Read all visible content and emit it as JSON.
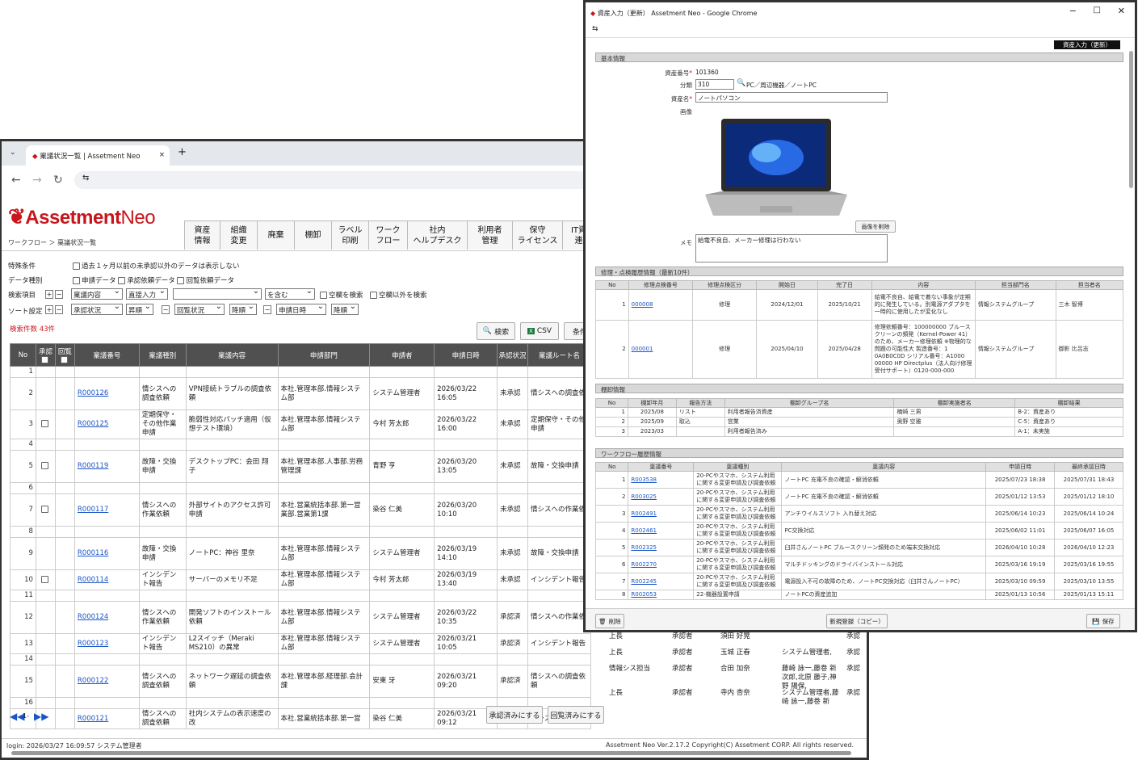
{
  "browser1": {
    "tab_title": "稟議状況一覧 | Assetment Neo"
  },
  "app": {
    "logo_main": "Assetment",
    "logo_neo": "Neo",
    "breadcrumb_root": "ワークフロー",
    "breadcrumb_sep": "＞",
    "breadcrumb_page": "稟議状況一覧",
    "menu": [
      "資産\n情報",
      "組織\n変更",
      "廃棄",
      "棚卸",
      "ラベル\n印刷",
      "ワーク\nフロー",
      "社内\nヘルプデスク",
      "利用者\n管理",
      "保守\nライセンス",
      "IT資\n連"
    ]
  },
  "search": {
    "special_label": "特殊条件",
    "special_opt": "過去１ヶ月以前の未承認以外のデータは表示しない",
    "datatype_label": "データ種別",
    "dt1": "申請データ",
    "dt2": "承認依頼データ",
    "dt3": "回覧依頼データ",
    "item_label": "検索項目",
    "item_field": "稟議内容",
    "item_mode": "直接入力",
    "item_value": "",
    "item_match": "を含む",
    "blank": "空欄を検索",
    "nonblank": "空欄以外を検索",
    "sort_label": "ソート設定",
    "sort1": "承認状況",
    "sort1o": "昇順",
    "sort2": "回覧状況",
    "sort2o": "降順",
    "sort3": "申請日時",
    "sort3o": "降順",
    "count": "検索件数 43件",
    "search_btn": "検索",
    "csv_btn": "CSV",
    "cond_btn": "条件"
  },
  "grid": {
    "headers": [
      "No",
      "承認",
      "回覧",
      "稟議番号",
      "稟議種別",
      "稟議内容",
      "申請部門",
      "申請者",
      "申請日時",
      "承認状況",
      "稟議ルート名"
    ],
    "rows": [
      {
        "no": "1",
        "id": "",
        "type": "",
        "content": "",
        "dept": "",
        "user": "",
        "date": "",
        "status": "",
        "route": "",
        "cb": false
      },
      {
        "no": "2",
        "id": "R000126",
        "type": "情シスへの調査依頼",
        "content": "VPN接続トラブルの調査依頼",
        "dept": "本社.管理本部.情報システム部",
        "user": "システム管理者",
        "date": "2026/03/22 16:05",
        "status": "未承認",
        "route": "情シスへの調査依",
        "cb": false
      },
      {
        "no": "3",
        "id": "R000125",
        "type": "定期保守・その他作業申請",
        "content": "脆弱性対応パッチ適用（仮想テスト環境）",
        "dept": "本社.管理本部.情報システム部",
        "user": "今村 芳太郎",
        "date": "2026/03/22 16:00",
        "status": "未承認",
        "route": "定期保守・その他申請",
        "cb": true
      },
      {
        "no": "4",
        "id": "",
        "type": "",
        "content": "",
        "dept": "",
        "user": "",
        "date": "",
        "status": "",
        "route": "",
        "cb": false
      },
      {
        "no": "5",
        "id": "R000119",
        "type": "故障・交換申請",
        "content": "デスクトップPC：会田 翔子",
        "dept": "本社.管理本部.人事部.労務管理課",
        "user": "青野 亨",
        "date": "2026/03/20 13:05",
        "status": "未承認",
        "route": "故障・交換申請",
        "cb": true
      },
      {
        "no": "6",
        "id": "",
        "type": "",
        "content": "",
        "dept": "",
        "user": "",
        "date": "",
        "status": "",
        "route": "",
        "cb": false
      },
      {
        "no": "7",
        "id": "R000117",
        "type": "情シスへの作業依頼",
        "content": "外部サイトのアクセス許可申請",
        "dept": "本社.営業統括本部.第一営業部.営業第1課",
        "user": "染谷 仁美",
        "date": "2026/03/20 10:10",
        "status": "未承認",
        "route": "情シスへの作業依",
        "cb": true
      },
      {
        "no": "8",
        "id": "",
        "type": "",
        "content": "",
        "dept": "",
        "user": "",
        "date": "",
        "status": "",
        "route": "",
        "cb": false
      },
      {
        "no": "9",
        "id": "R000116",
        "type": "故障・交換申請",
        "content": "ノートPC：神谷 里奈",
        "dept": "本社.管理本部.情報システム部",
        "user": "システム管理者",
        "date": "2026/03/19 14:10",
        "status": "未承認",
        "route": "故障・交換申請",
        "cb": false
      },
      {
        "no": "10",
        "id": "R000114",
        "type": "インシデント報告",
        "content": "サーバーのメモリ不足",
        "dept": "本社.管理本部.情報システム部",
        "user": "今村 芳太郎",
        "date": "2026/03/19 13:40",
        "status": "未承認",
        "route": "インシデント報告",
        "cb": true
      },
      {
        "no": "11",
        "id": "",
        "type": "",
        "content": "",
        "dept": "",
        "user": "",
        "date": "",
        "status": "",
        "route": "",
        "cb": false
      },
      {
        "no": "12",
        "id": "R000124",
        "type": "情シスへの作業依頼",
        "content": "開発ソフトのインストール依頼",
        "dept": "本社.管理本部.情報システム部",
        "user": "システム管理者",
        "date": "2026/03/22 10:35",
        "status": "承認済",
        "route": "情シスへの作業依",
        "cb": false
      },
      {
        "no": "13",
        "id": "R000123",
        "type": "インシデント報告",
        "content": "L2スイッチ（Meraki MS210）の異常",
        "dept": "本社.管理本部.情報システム部",
        "user": "システム管理者",
        "date": "2026/03/21 10:05",
        "status": "承認済",
        "route": "インシデント報告",
        "cb": false
      },
      {
        "no": "14",
        "id": "",
        "type": "",
        "content": "",
        "dept": "",
        "user": "",
        "date": "",
        "status": "",
        "route": "",
        "cb": false
      },
      {
        "no": "15",
        "id": "R000122",
        "type": "情シスへの調査依頼",
        "content": "ネットワーク遅延の調査依頼",
        "dept": "本社.管理本部.経理部.会計課",
        "user": "安東 牙",
        "date": "2026/03/21 09:20",
        "status": "承認済",
        "route": "情シスへの調査依頼",
        "cb": false
      },
      {
        "no": "16",
        "id": "",
        "type": "",
        "content": "",
        "dept": "",
        "user": "",
        "date": "",
        "status": "",
        "route": "",
        "cb": false
      },
      {
        "no": "",
        "id": "R000121",
        "type": "情シスへの調査依頼",
        "content": "社内システムの表示速度の改",
        "dept": "本社.営業統括本部.第一営",
        "user": "染谷 仁美",
        "date": "2026/03/21 09:12",
        "status": "承認済",
        "route": "情シスへの調",
        "cb": false
      }
    ]
  },
  "approver": [
    {
      "role": "上長",
      "st": "承認者",
      "name": "須田 好晃",
      "grp": "",
      "x": "承認"
    },
    {
      "role": "上長",
      "st": "承認者",
      "name": "玉城 正春",
      "grp": "システム管理者,",
      "x": "承認"
    },
    {
      "role": "情報シス担当",
      "st": "承認者",
      "name": "合田 加奈",
      "grp": "藤崎 詠一,藤巻 新次郎,北原 藤子,神野 陽保,",
      "x": "承認"
    },
    {
      "role": "上長",
      "st": "承認者",
      "name": "寺内 杏奈",
      "grp": "システム管理者,藤崎 詠一,藤巻 新",
      "x": "承認"
    }
  ],
  "footer": {
    "pager": "1-",
    "approve_btn": "承認済みにする",
    "read_btn": "回覧済みにする",
    "login": "login: 2026/03/27 16:09:57 システム管理者",
    "copyright": "Assetment Neo Ver.2.17.2 Copyright(C) Assetment CORP. All rights reserved."
  },
  "win2": {
    "title": "資産入力（更新） Assetment Neo - Google Chrome",
    "badge": "資産入力（更新）",
    "sec_basic": "基本情報",
    "asset_no_label": "資産番号",
    "asset_no": "101360",
    "cat_label": "分類",
    "cat_code": "310",
    "cat_name": "PC／周辺機器／ノートPC",
    "name_label": "資産名",
    "name": "ノートパソコン",
    "image_label": "画像",
    "del_img": "画像を削除",
    "memo_label": "メモ",
    "memo": "給電不良自、メーカー修理は行わない",
    "sec_repair": "修理・点検履歴情報（最新10件）",
    "repair_headers": [
      "No",
      "修理点検番号",
      "修理点検区分",
      "開始日",
      "完了日",
      "内容",
      "担当部門名",
      "担当者名"
    ],
    "repair": [
      {
        "no": "1",
        "id": "000008",
        "kind": "修理",
        "start": "2024/12/01",
        "end": "2025/10/21",
        "content": "給電不良自、給電で着ない事象が定期的に発生している。別電源アダプタを一時的に使用したが変化なし",
        "dept": "情報システムグループ",
        "user": "三木 智博"
      },
      {
        "no": "2",
        "id": "000001",
        "kind": "修理",
        "start": "2025/04/10",
        "end": "2025/04/28",
        "content": "修理依頼番号：100000000 ブルースクリーンの頻発（Kernel-Power 41）のため、メーカー修理依頼 ※物理的な問題の可能性大 製造番号：1 0A0B0C0D シリアル番号：A1000 00000 HP Directplus（法人向け修理受付サポート）0120-000-000",
        "dept": "情報システムグループ",
        "user": "御影 比呂志"
      }
    ],
    "sec_inv": "棚卸情報",
    "inv_headers": [
      "No",
      "棚卸年月",
      "報告方法",
      "棚卸グループ名",
      "棚卸実施者名",
      "棚卸結果"
    ],
    "inv": [
      {
        "no": "1",
        "ym": "2025/08",
        "m": "リスト",
        "g": "利用者報告済資産",
        "u": "楠崎 三男",
        "r": "B-2：資産あり"
      },
      {
        "no": "2",
        "ym": "2025/09",
        "m": "取込",
        "g": "営業",
        "u": "奥野 空雅",
        "r": "C-5：資産あり"
      },
      {
        "no": "3",
        "ym": "2023/03",
        "m": "",
        "g": "利用者報告済み",
        "u": "",
        "r": "A-1：未実施"
      }
    ],
    "sec_wf": "ワークフロー履歴情報",
    "wf_headers": [
      "No",
      "稟議番号",
      "稟議種別",
      "稟議内容",
      "申請日時",
      "最終承認日時"
    ],
    "wf": [
      {
        "no": "1",
        "id": "R003538",
        "k": "20-PCやスマホ、システム利用に関する変更申請及び調査依頼",
        "c": "ノートPC 充電不良の確認・解消依頼",
        "a": "2025/07/23 18:38",
        "f": "2025/07/31 18:43"
      },
      {
        "no": "2",
        "id": "R003025",
        "k": "20-PCやスマホ、システム利用に関する変更申請及び調査依頼",
        "c": "ノートPC 充電不良の確認・解消依頼",
        "a": "2025/01/12 13:53",
        "f": "2025/01/12 18:10"
      },
      {
        "no": "3",
        "id": "R002491",
        "k": "20-PCやスマホ、システム利用に関する変更申請及び調査依頼",
        "c": "アンチウイルスソフト 入れ替え対応",
        "a": "2025/06/14 10:23",
        "f": "2025/06/14 10:24"
      },
      {
        "no": "4",
        "id": "R002461",
        "k": "20-PCやスマホ、システム利用に関する変更申請及び調査依頼",
        "c": "PC交換対応",
        "a": "2025/06/02 11:01",
        "f": "2025/06/07 16:05"
      },
      {
        "no": "5",
        "id": "R002325",
        "k": "20-PCやスマホ、システム利用に関する変更申請及び調査依頼",
        "c": "臼井さんノートPC ブルースクリーン頻発のため端末交換対応",
        "a": "2026/04/10 10:28",
        "f": "2026/04/10 12:23"
      },
      {
        "no": "6",
        "id": "R002270",
        "k": "20-PCやスマホ、システム利用に関する変更申請及び調査依頼",
        "c": "マルチドッキングのドライバインストール対応",
        "a": "2025/03/16 19:19",
        "f": "2025/03/16 19:55"
      },
      {
        "no": "7",
        "id": "R002245",
        "k": "20-PCやスマホ、システム利用に関する変更申請及び調査依頼",
        "c": "電源投入不可の故障のため、ノートPC交換対応（臼井さんノートPC）",
        "a": "2025/03/10 09:59",
        "f": "2025/03/10 13:55"
      },
      {
        "no": "8",
        "id": "R002053",
        "k": "22-機器設置申請",
        "c": "ノートPCの資産追加",
        "a": "2025/01/13 10:56",
        "f": "2025/01/13 15:11"
      }
    ],
    "delete_btn": "削除",
    "copy_btn": "新規登録（コピー）",
    "save_btn": "保存"
  },
  "colors": {
    "brand": "#c8161d",
    "header_dark": "#505050",
    "link": "#1a55c8"
  }
}
